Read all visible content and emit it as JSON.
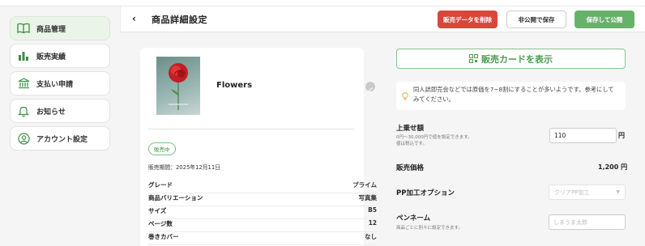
{
  "sidebar": {
    "items": [
      {
        "label": "商品管理",
        "icon": "book-icon",
        "active": true
      },
      {
        "label": "販売実績",
        "icon": "bar-chart-icon"
      },
      {
        "label": "支払い申請",
        "icon": "bank-icon"
      },
      {
        "label": "お知らせ",
        "icon": "bell-icon"
      },
      {
        "label": "アカウント設定",
        "icon": "account-icon"
      }
    ]
  },
  "header": {
    "back": "‹",
    "title": "商品詳細設定",
    "delete_label": "販売データを削除",
    "private_save_label": "非公開で保存",
    "publish_label": "保存して公開"
  },
  "product": {
    "name": "Flowers",
    "status": "販売中",
    "period": "販売期間：2025年12月11日",
    "specs": [
      {
        "key": "グレード",
        "value": "プライム"
      },
      {
        "key": "商品バリエーション",
        "value": "写真集"
      },
      {
        "key": "サイズ",
        "value": "B5"
      },
      {
        "key": "ページ数",
        "value": "12"
      },
      {
        "key": "巻きカバー",
        "value": "なし"
      }
    ]
  },
  "settings": {
    "card_button": "販売カードを表示",
    "tip": "同人誌即売会などでは原価を7~8割にすることが多いようです。参考にしてみてください。",
    "markup_label": "上乗せ額",
    "markup_help": [
      "0円〜30,000円で値を設定できます。",
      "値は税込です。"
    ],
    "markup_value": "110",
    "unit_yen": "円",
    "sale_price_label": "販売価格",
    "sale_price": "1,200 円",
    "pp_label": "PP加工オプション",
    "pp_placeholder": "クリアPP加工",
    "penname_label": "ペンネーム",
    "penname_help": "商品ごとに別々に設定できます。",
    "penname_placeholder": "しまうま太郎"
  }
}
